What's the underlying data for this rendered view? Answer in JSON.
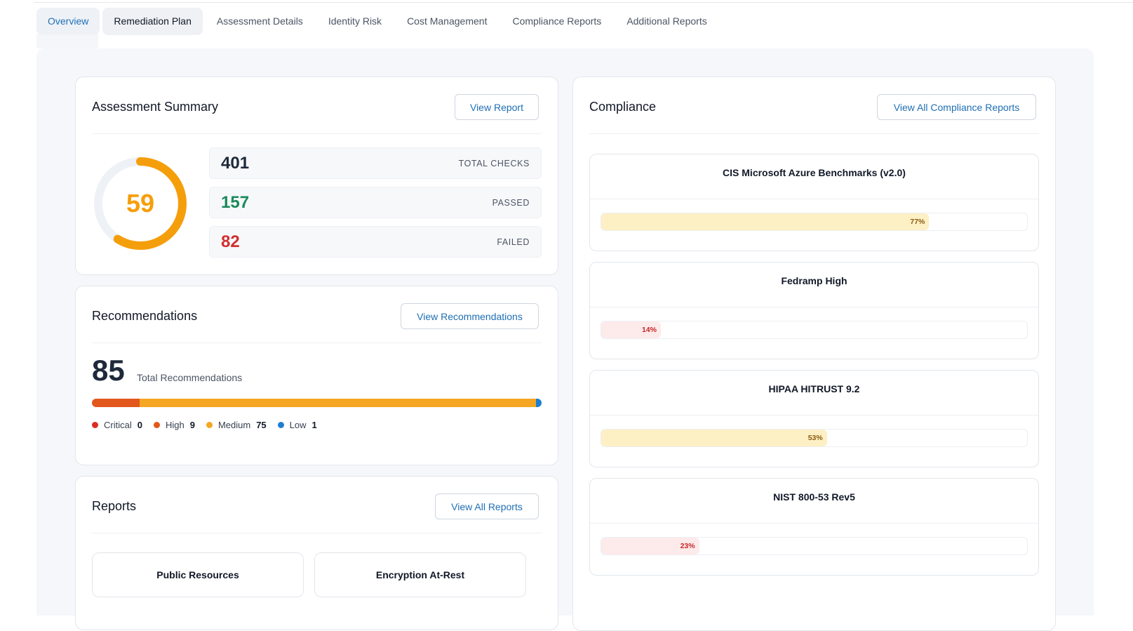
{
  "tabs": [
    {
      "label": "Overview"
    },
    {
      "label": "Remediation Plan"
    },
    {
      "label": "Assessment Details"
    },
    {
      "label": "Identity Risk"
    },
    {
      "label": "Cost Management"
    },
    {
      "label": "Compliance Reports"
    },
    {
      "label": "Additional Reports"
    }
  ],
  "assessment": {
    "title": "Assessment Summary",
    "button": "View Report",
    "score": "59",
    "score_fraction": 0.59,
    "score_color": "#f59e0b",
    "stats": [
      {
        "value": "401",
        "label": "TOTAL CHECKS",
        "color": "#1e293b"
      },
      {
        "value": "157",
        "label": "PASSED",
        "color": "#1a8a5a"
      },
      {
        "value": "82",
        "label": "FAILED",
        "color": "#d32f2f"
      }
    ]
  },
  "recommendations": {
    "title": "Recommendations",
    "button": "View Recommendations",
    "total": "85",
    "total_label": "Total Recommendations",
    "levels": [
      {
        "name": "Critical",
        "count": "0",
        "value": 0,
        "color": "#d92d20"
      },
      {
        "name": "High",
        "count": "9",
        "value": 9,
        "color": "#e2571c"
      },
      {
        "name": "Medium",
        "count": "75",
        "value": 75,
        "color": "#f5a623"
      },
      {
        "name": "Low",
        "count": "1",
        "value": 1,
        "color": "#1e7fd0"
      }
    ]
  },
  "reports": {
    "title": "Reports",
    "button": "View All Reports",
    "items": [
      {
        "label": "Public Resources"
      },
      {
        "label": "Encryption At-Rest"
      }
    ]
  },
  "compliance": {
    "title": "Compliance",
    "button": "View All Compliance Reports",
    "items": [
      {
        "name": "CIS Microsoft Azure Benchmarks (v2.0)",
        "percent": 77,
        "percent_label": "77%",
        "fill": "#fdf0c4",
        "text": "#8a5a12"
      },
      {
        "name": "Fedramp High",
        "percent": 14,
        "percent_label": "14%",
        "fill": "#fdeaea",
        "text": "#c62828"
      },
      {
        "name": "HIPAA HITRUST 9.2",
        "percent": 53,
        "percent_label": "53%",
        "fill": "#fdf0c4",
        "text": "#8a5a12"
      },
      {
        "name": "NIST 800-53 Rev5",
        "percent": 23,
        "percent_label": "23%",
        "fill": "#fdeaea",
        "text": "#c62828"
      }
    ]
  }
}
